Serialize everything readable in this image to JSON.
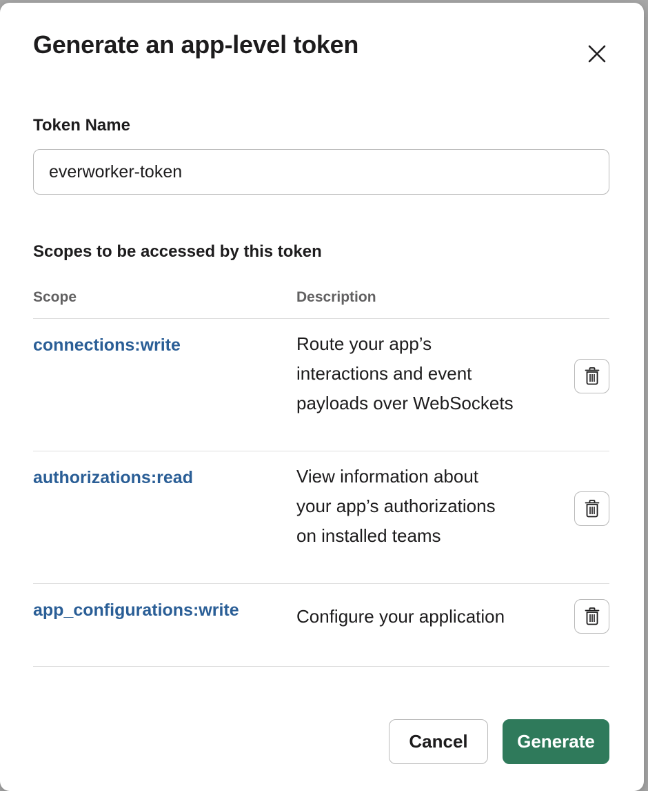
{
  "modal": {
    "title": "Generate an app-level token",
    "close_icon": "close-icon"
  },
  "token_name": {
    "label": "Token Name",
    "value": "everworker-token"
  },
  "scopes": {
    "section_title": "Scopes to be accessed by this token",
    "headers": {
      "scope": "Scope",
      "description": "Description"
    },
    "rows": [
      {
        "name": "connections:write",
        "description_lines": [
          "Route your app’s",
          "interactions and event",
          "payloads over WebSockets"
        ],
        "delete_icon": "trash-icon"
      },
      {
        "name": "authorizations:read",
        "description_lines": [
          "View information about",
          "your app’s authorizations",
          "on installed teams"
        ],
        "delete_icon": "trash-icon"
      },
      {
        "name": "app_configurations:write",
        "description_lines": [
          "Configure your application"
        ],
        "delete_icon": "trash-icon"
      }
    ]
  },
  "footer": {
    "cancel_label": "Cancel",
    "generate_label": "Generate"
  },
  "colors": {
    "scope_link": "#2a5e96",
    "primary_button": "#2f7a5b",
    "text": "#1d1c1d",
    "muted_text": "#616061",
    "border": "#b8b8b8"
  }
}
